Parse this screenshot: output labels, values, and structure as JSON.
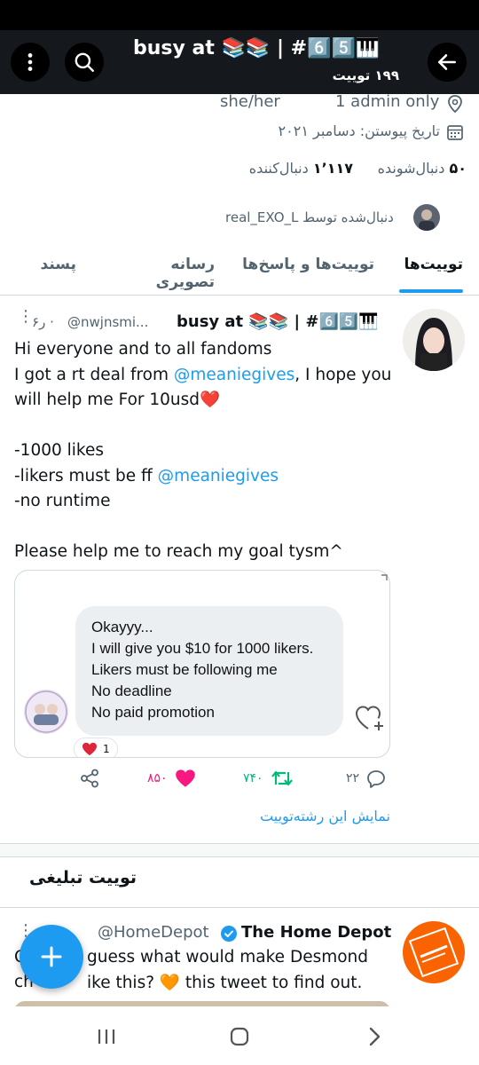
{
  "header": {
    "title": "busy at 📚📚 | #6️⃣5️⃣🎹",
    "tweet_count": "۱۹۹ توییت"
  },
  "profile": {
    "pronouns": "she/her",
    "location": "1 admin only",
    "joined": "تاریخ پیوستن: دسامبر ۲۰۲۱",
    "following_count": "۵۰",
    "following_label": "دنبال‌شونده",
    "followers_count": "۱٬۱۱۷",
    "followers_label": "دنبال‌کننده",
    "followed_by_label": "دنبال‌شده توسط",
    "followed_by_user": "real_EXO_L"
  },
  "tabs": [
    {
      "label": "توییت‌ها",
      "active": true
    },
    {
      "label": "توییت‌ها و پاسخ‌ها",
      "active": false
    },
    {
      "label": "رسانه تصویری",
      "active": false
    },
    {
      "label": "پسند",
      "active": false
    }
  ],
  "tweet": {
    "name": "busy at 📚📚 | #6️⃣5️⃣🎹",
    "handle": "@nwjnsmi...",
    "time": "۶ر ·",
    "lines": [
      {
        "text": "Hi everyone and to all fandoms"
      },
      {
        "pre": "I got a rt deal from ",
        "link": "@meaniegives",
        "post": ", I hope you"
      },
      {
        "text": "will help me For 10usd❤️"
      },
      {
        "text": ""
      },
      {
        "text": "-1000 likes"
      },
      {
        "pre": "-likers must be ff ",
        "link": "@meaniegives",
        "post": ""
      },
      {
        "text": "-no runtime"
      },
      {
        "text": ""
      },
      {
        "text": "Please help me to reach my goal tysm^"
      }
    ],
    "embed_message": [
      "Okayyy...",
      "I will give you $10 for 1000 likers.",
      "Likers must be following me",
      "No deadline",
      "No paid promotion"
    ],
    "reaction_count": "1",
    "replies": "۲۲",
    "retweets": "۷۴۰",
    "likes": "۸۵۰",
    "show_thread": "نمایش این رشته‌توییت"
  },
  "promoted": {
    "section_title": "توییت تبلیغی",
    "name": "The Home Depot",
    "handle": "@HomeDepot",
    "line1": "guess what would make Desmond",
    "line2_pre": "ch",
    "line2_post": "ike this? 🧡 this tweet to find out.",
    "line1_pre": "C"
  },
  "colors": {
    "accent": "#1d9bf0",
    "like": "#f91880",
    "retweet": "#00ba7c",
    "header_bg": "#15181c",
    "home_depot": "#f96302"
  }
}
